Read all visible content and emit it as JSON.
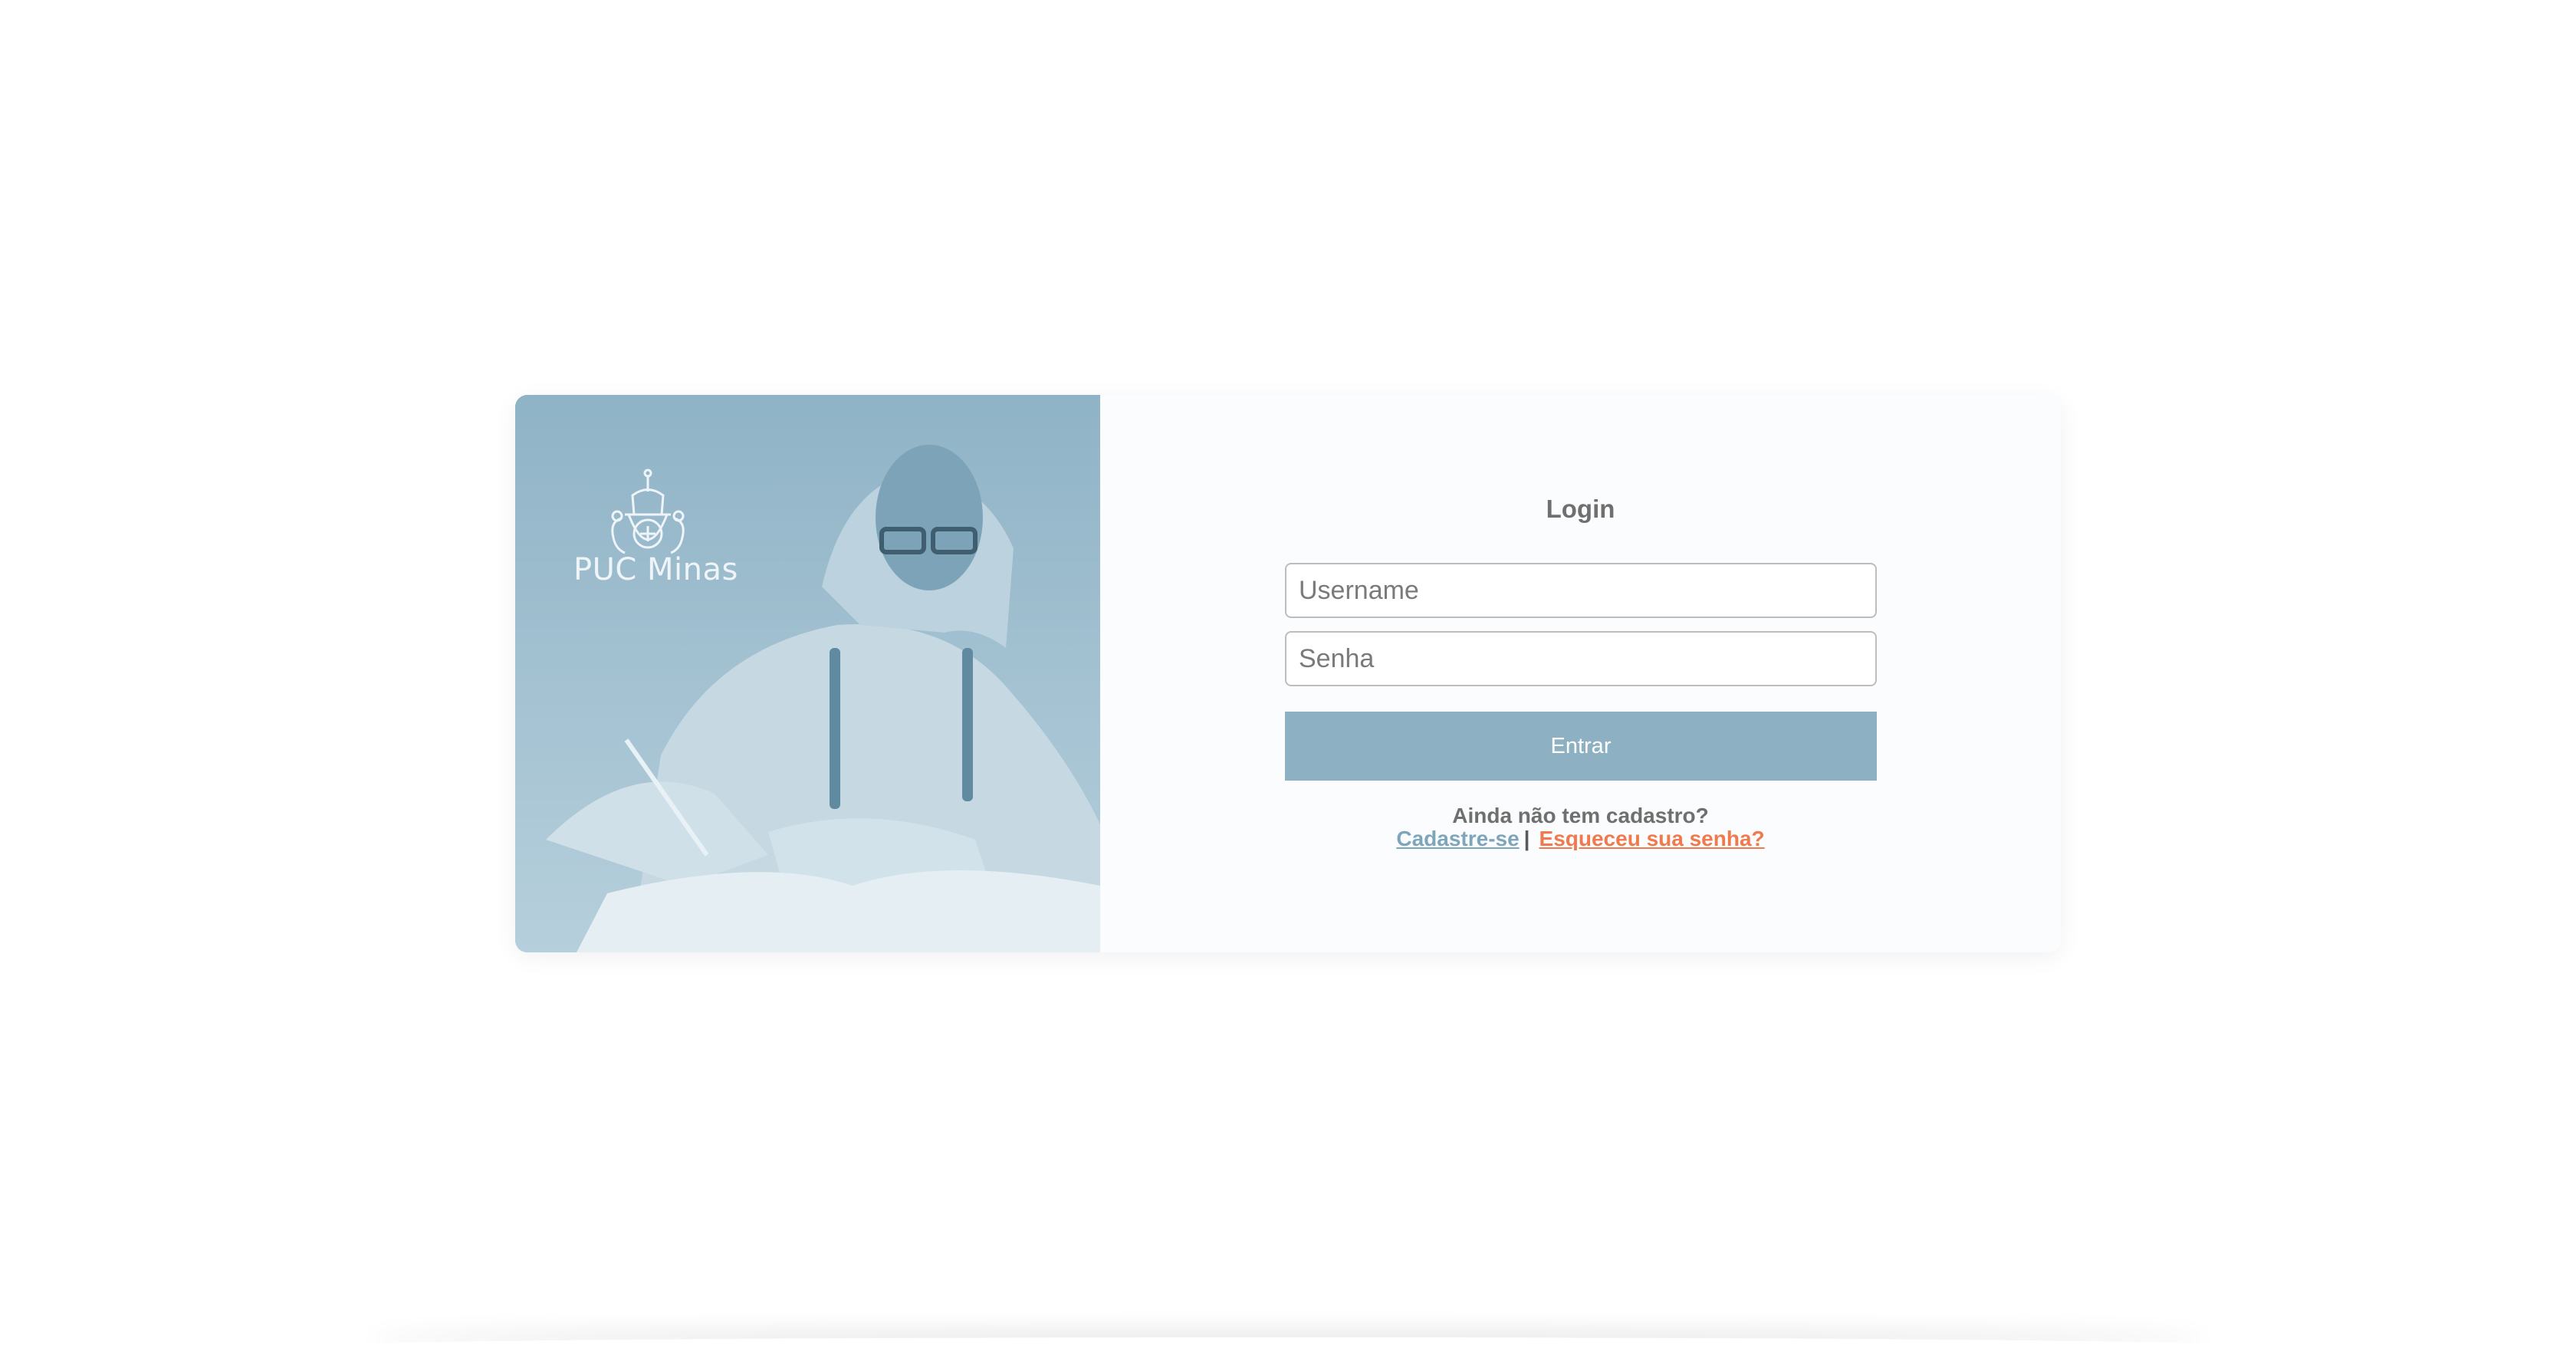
{
  "brand": {
    "name": "PUC Minas",
    "accent_color": "#8db0c2",
    "link_signup_color": "#7ea6bb",
    "link_forgot_color": "#f07a4d"
  },
  "hero": {
    "image": "student-writing-photo",
    "logo_icon": "puc-minas-crest-icon"
  },
  "login": {
    "title": "Login",
    "username_placeholder": "Username",
    "username_value": "",
    "password_placeholder": "Senha",
    "password_value": "",
    "submit_label": "Entrar",
    "signup_prompt": "Ainda não tem cadastro?",
    "signup_link": "Cadastre-se",
    "separator": "|",
    "forgot_link": "Esqueceu sua senha?"
  }
}
